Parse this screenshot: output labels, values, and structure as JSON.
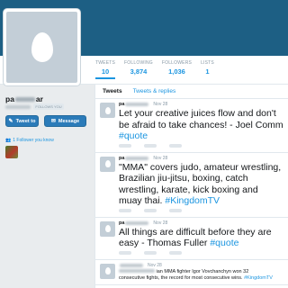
{
  "stats": [
    {
      "label": "TWEETS",
      "value": "10"
    },
    {
      "label": "FOLLOWING",
      "value": "3,874"
    },
    {
      "label": "FOLLOWERS",
      "value": "1,036"
    },
    {
      "label": "LISTS",
      "value": "1"
    }
  ],
  "profile": {
    "name_start": "pa",
    "name_end": "ar",
    "follows_you": "FOLLOWS YOU",
    "tweet_button": "Tweet to",
    "message_button": "Message",
    "followers_you_know": "1 Follower you know"
  },
  "tabs": [
    "Tweets",
    "Tweets & replies"
  ],
  "tweets": [
    {
      "user": "pa",
      "time": "Nov 28",
      "text": "Let your creative juices flow and don't be afraid to take chances! - Joel Comm ",
      "hashtags": "#quote"
    },
    {
      "user": "pa",
      "time": "Nov 28",
      "text": "\"MMA\" covers judo, amateur wrestling, Brazilian jiu-jitsu, boxing, catch wrestling, karate, kick boxing and muay thai. ",
      "hashtags": "#KingdomTV"
    },
    {
      "user": "pa",
      "time": "Nov 28",
      "text": "All things are difficult before they are easy - Thomas Fuller ",
      "hashtags": "#quote"
    },
    {
      "user": "",
      "time": "Nov 28",
      "line1": "ian MMA fighter Igor Vovchanchyn won 32",
      "line2": "consecutive fights, the record for most consecutive wins. ",
      "hashtags": "#KingdomTV"
    }
  ]
}
